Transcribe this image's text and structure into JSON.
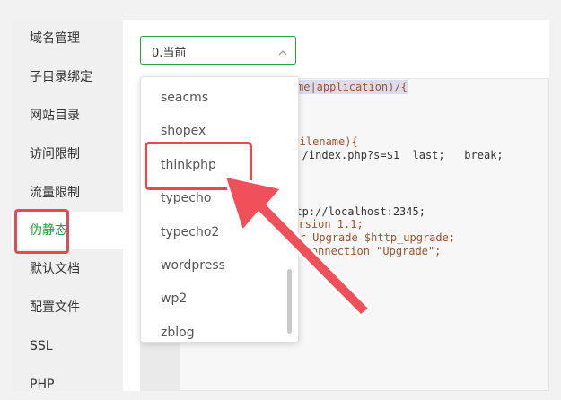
{
  "sidebar": {
    "items": [
      {
        "label": "域名管理"
      },
      {
        "label": "子目录绑定"
      },
      {
        "label": "网站目录"
      },
      {
        "label": "访问限制"
      },
      {
        "label": "流量限制"
      },
      {
        "label": "伪静态",
        "active": true
      },
      {
        "label": "默认文档"
      },
      {
        "label": "配置文件"
      },
      {
        "label": "SSL"
      },
      {
        "label": "PHP"
      }
    ]
  },
  "rewrite": {
    "select_value": "0.当前",
    "options": [
      "seacms",
      "shopex",
      "thinkphp",
      "typecho",
      "typecho2",
      "wordpress",
      "wp2",
      "zblog"
    ],
    "highlighted_option": "thinkphp"
  },
  "editor": {
    "lines": [
      "me|application)/{",
      "t_filename){",
      "$  /index.php?s=$1  last;   break;",
      "http://localhost:2345;",
      "version 1.1;",
      "ader Upgrade $http_upgrade;",
      "er Connection \"Upgrade\";"
    ]
  },
  "colors": {
    "accent": "#20a53a",
    "highlight": "#e54a50"
  }
}
